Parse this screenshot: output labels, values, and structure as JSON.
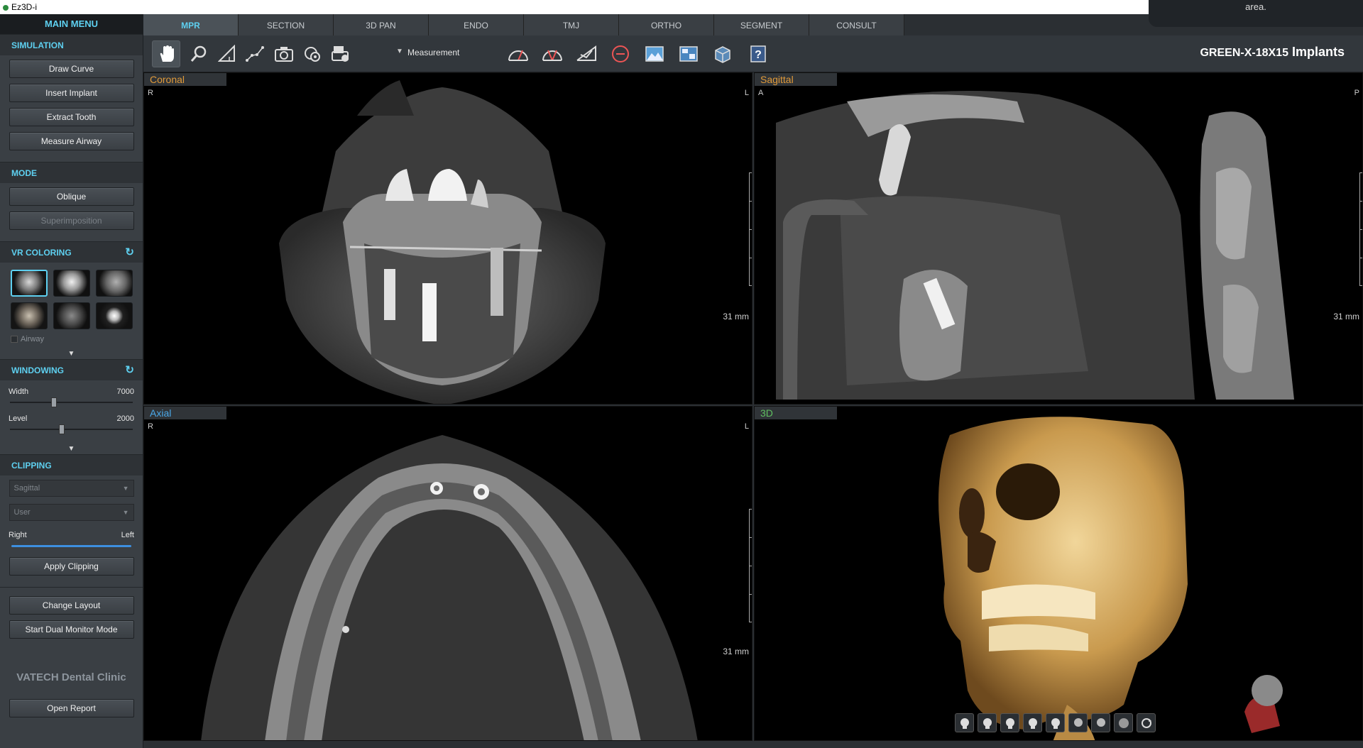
{
  "app": {
    "title": "Ez3D-i",
    "notice": "area."
  },
  "sidebar": {
    "header": "MAIN MENU",
    "simulation": {
      "title": "SIMULATION",
      "buttons": [
        "Draw Curve",
        "Insert Implant",
        "Extract Tooth",
        "Measure Airway"
      ]
    },
    "mode": {
      "title": "MODE",
      "buttons": [
        "Oblique",
        "Superimposition"
      ]
    },
    "vr_coloring": {
      "title": "VR COLORING",
      "airway_label": "Airway",
      "presets": [
        "preset-1",
        "preset-2",
        "preset-3",
        "preset-4",
        "preset-5",
        "preset-6"
      ]
    },
    "windowing": {
      "title": "WINDOWING",
      "width_label": "Width",
      "width_value": "7000",
      "level_label": "Level",
      "level_value": "2000",
      "width_fraction": 0.36,
      "level_fraction": 0.42
    },
    "clipping": {
      "title": "CLIPPING",
      "plane": "Sagittal",
      "mode": "User",
      "left_label": "Right",
      "right_label": "Left",
      "apply": "Apply Clipping"
    },
    "change_layout": "Change Layout",
    "dual_monitor": "Start Dual Monitor Mode",
    "clinic": "VATECH Dental Clinic",
    "open_report": "Open Report"
  },
  "tabs": [
    "MPR",
    "SECTION",
    "3D PAN",
    "ENDO",
    "TMJ",
    "ORTHO",
    "SEGMENT",
    "CONSULT"
  ],
  "active_tab": "MPR",
  "toolbar": {
    "measurement_label": "Measurement",
    "product_name": "GREEN-X-18X15",
    "product_suffix": "Implants",
    "icons": [
      "pan-icon",
      "zoom-icon",
      "angle-icon",
      "polyline-icon",
      "camera-icon",
      "capture-icon",
      "print-icon",
      "arc-measure-icon",
      "arc-measure-2-icon",
      "angle-measure-icon",
      "circle-measure-icon",
      "image-adjust-icon",
      "layout-icon",
      "volume-icon",
      "help-icon"
    ]
  },
  "views": {
    "coronal": {
      "label": "Coronal",
      "left": "R",
      "right": "L",
      "scale": "31 mm"
    },
    "sagittal": {
      "label": "Sagittal",
      "left": "A",
      "right": "P",
      "scale": "31 mm"
    },
    "axial": {
      "label": "Axial",
      "left": "R",
      "right": "L",
      "scale": "31 mm"
    },
    "volume": {
      "label": "3D"
    }
  },
  "colors": {
    "accent": "#5ed0f0",
    "coronal_label": "#e09a3a",
    "axial_label": "#4aa8e8",
    "volume_label": "#5fbf60",
    "bone": "#d9b36a"
  }
}
